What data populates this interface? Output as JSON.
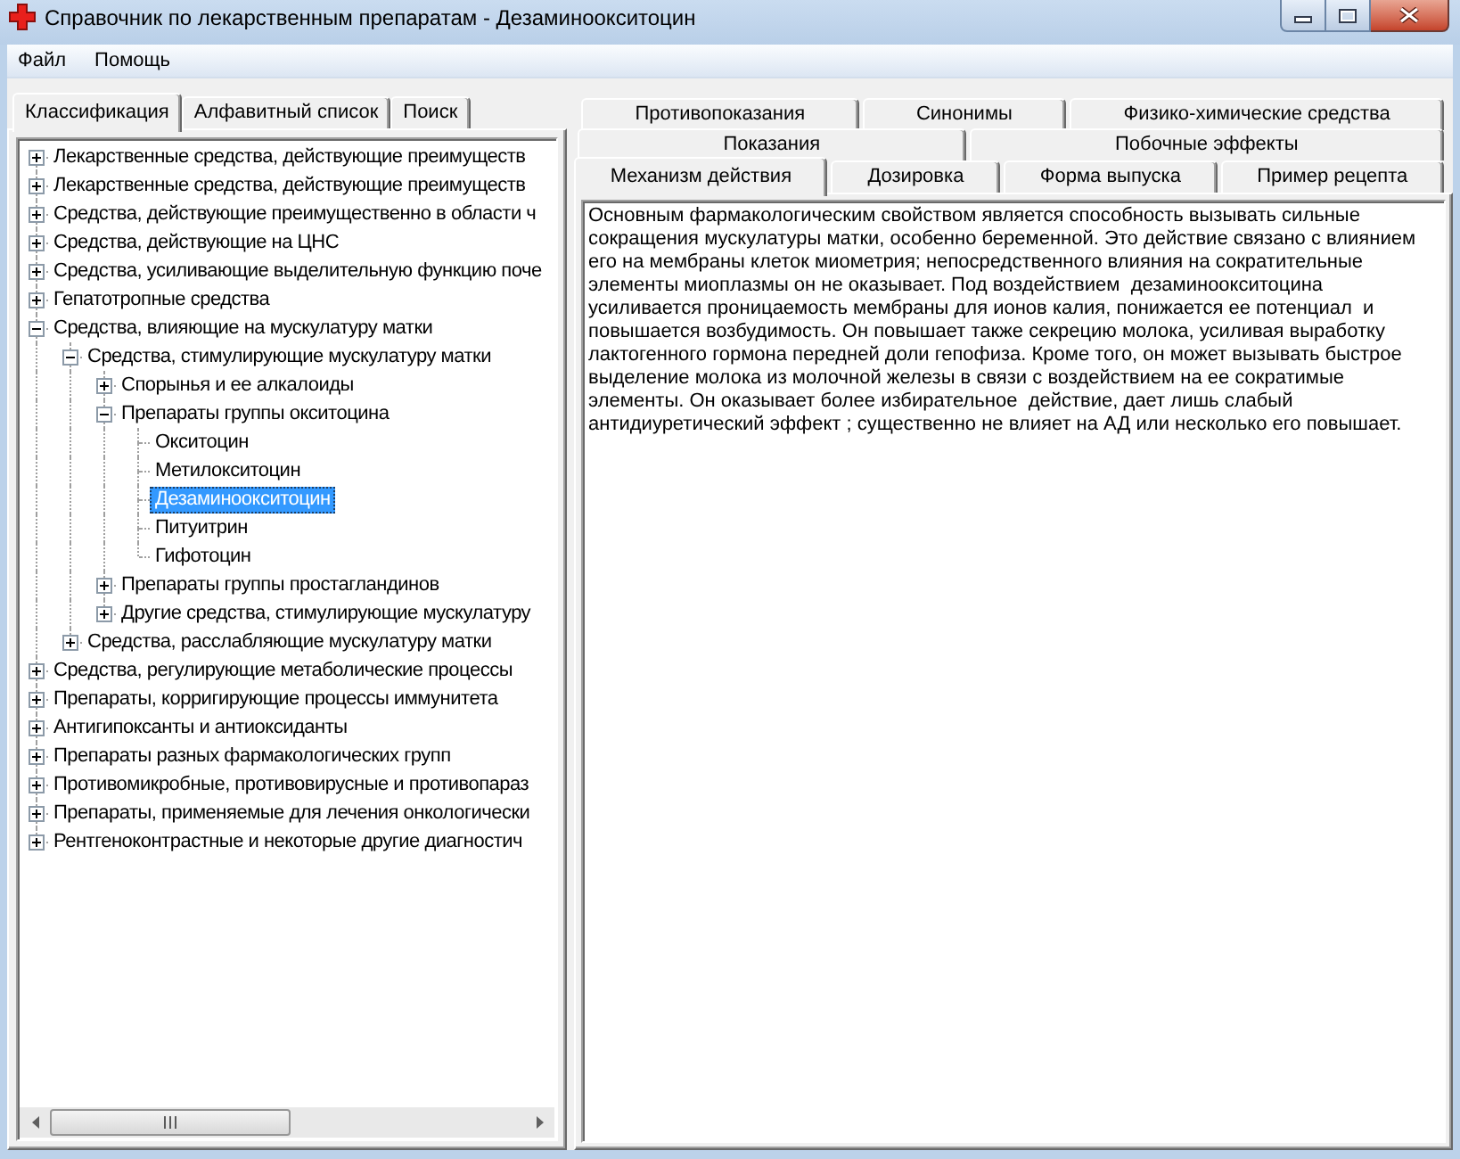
{
  "window": {
    "title": "Справочник по лекарственным препаратам - Дезаминоокситоцин"
  },
  "menu": [
    {
      "label": "Файл"
    },
    {
      "label": "Помощь"
    }
  ],
  "nav_tabs": [
    {
      "label": "Классификация",
      "selected": true
    },
    {
      "label": "Алфавитный список",
      "selected": false
    },
    {
      "label": "Поиск",
      "selected": false
    }
  ],
  "tree": [
    {
      "label": "Лекарственные средства, действующие преимуществ",
      "expanded": false,
      "selected": false
    },
    {
      "label": "Лекарственные средства, действующие преимуществ",
      "expanded": false,
      "selected": false
    },
    {
      "label": "Средства, действующие преимущественно в области ч",
      "expanded": false,
      "selected": false
    },
    {
      "label": "Средства, действующие на ЦНС",
      "expanded": false,
      "selected": false
    },
    {
      "label": "Средства, усиливающие выделительную функцию поче",
      "expanded": false,
      "selected": false
    },
    {
      "label": "Гепатотропные средства",
      "expanded": false,
      "selected": false
    },
    {
      "label": "Средства, влияющие на мускулатуру матки",
      "expanded": true,
      "selected": false,
      "children": [
        {
          "label": "Средства, стимулирующие мускулатуру матки",
          "expanded": true,
          "selected": false,
          "children": [
            {
              "label": "Спорынья и ее алкалоиды",
              "expanded": false,
              "selected": false
            },
            {
              "label": "Препараты группы окситоцина",
              "expanded": true,
              "selected": false,
              "children": [
                {
                  "label": "Окситоцин",
                  "selected": false
                },
                {
                  "label": "Метилокситоцин",
                  "selected": false
                },
                {
                  "label": "Дезаминоокситоцин",
                  "selected": true
                },
                {
                  "label": "Питуитрин",
                  "selected": false
                },
                {
                  "label": "Гифотоцин",
                  "selected": false
                }
              ]
            },
            {
              "label": "Препараты группы простагландинов",
              "expanded": false,
              "selected": false
            },
            {
              "label": "Другие средства, стимулирующие мускулатуру",
              "expanded": false,
              "selected": false
            }
          ]
        },
        {
          "label": "Средства, расслабляющие мускулатуру матки",
          "expanded": false,
          "selected": false
        }
      ]
    },
    {
      "label": "Средства, регулирующие метаболические процессы",
      "expanded": false,
      "selected": false
    },
    {
      "label": "Препараты, корригирующие процессы иммунитета",
      "expanded": false,
      "selected": false
    },
    {
      "label": "Антигипоксанты и антиоксиданты",
      "expanded": false,
      "selected": false
    },
    {
      "label": "Препараты разных фармакологических групп",
      "expanded": false,
      "selected": false
    },
    {
      "label": "Противомикробные, противовирусные и противопараз",
      "expanded": false,
      "selected": false
    },
    {
      "label": "Препараты, применяемые для лечения онкологически",
      "expanded": false,
      "selected": false
    },
    {
      "label": "Рентгеноконтрастные и некоторые другие диагностич",
      "expanded": false,
      "selected": false
    }
  ],
  "detail_tab_rows": [
    {
      "tabs": [
        {
          "label": "Противопоказания",
          "selected": false
        },
        {
          "label": "Синонимы",
          "selected": false
        },
        {
          "label": "Физико-химические средства",
          "selected": false
        }
      ]
    },
    {
      "tabs": [
        {
          "label": "Показания",
          "selected": false
        },
        {
          "label": "Побочные эффекты",
          "selected": false
        }
      ]
    },
    {
      "tabs": [
        {
          "label": "Механизм действия",
          "selected": true
        },
        {
          "label": "Дозировка",
          "selected": false
        },
        {
          "label": "Форма выпуска",
          "selected": false
        },
        {
          "label": "Пример рецепта",
          "selected": false
        }
      ]
    }
  ],
  "description": {
    "lines": [
      "Основным фармакологическим свойством является способность вызывать сильные",
      "сокращения мускулатуры матки, особенно беременной. Это действие связано с влиянием",
      "его на мембраны клеток миометрия; непосредственного влияния на сократительные",
      "элементы миоплазмы он не оказывает. Под воздействием  дезаминоокситоцина",
      "усиливается проницаемость мембраны для ионов калия, понижается ее потенциал  и",
      "повышается возбудимость. Он повышает также секрецию молока, усиливая выработку",
      "лактогенного гормона передней доли гепофиза. Кроме того, он может вызывать быстрое",
      "выделение молока из молочной железы в связи с воздействием на ее сократимые",
      "элементы. Он оказывает более избирательное  действие, дает лишь слабый",
      "антидиуретический эффект ; существенно не влияет на АД или несколько его повышает."
    ]
  }
}
